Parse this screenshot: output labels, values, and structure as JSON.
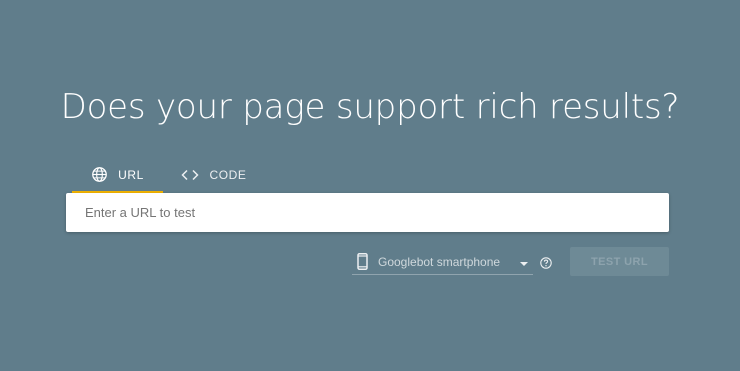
{
  "headline": "Does your page support rich results?",
  "tabs": [
    {
      "label": "URL",
      "icon": "globe-icon",
      "active": true
    },
    {
      "label": "CODE",
      "icon": "code-icon",
      "active": false
    }
  ],
  "url_input": {
    "value": "",
    "placeholder": "Enter a URL to test"
  },
  "device_select": {
    "selected": "Googlebot smartphone",
    "icon": "smartphone-icon"
  },
  "help_icon": "help-circle-icon",
  "test_button": {
    "label": "TEST URL",
    "enabled": false
  },
  "colors": {
    "background": "#607d8b",
    "tab_indicator": "#f4b400",
    "input_background": "#ffffff",
    "button_disabled": "#6e8a96"
  }
}
